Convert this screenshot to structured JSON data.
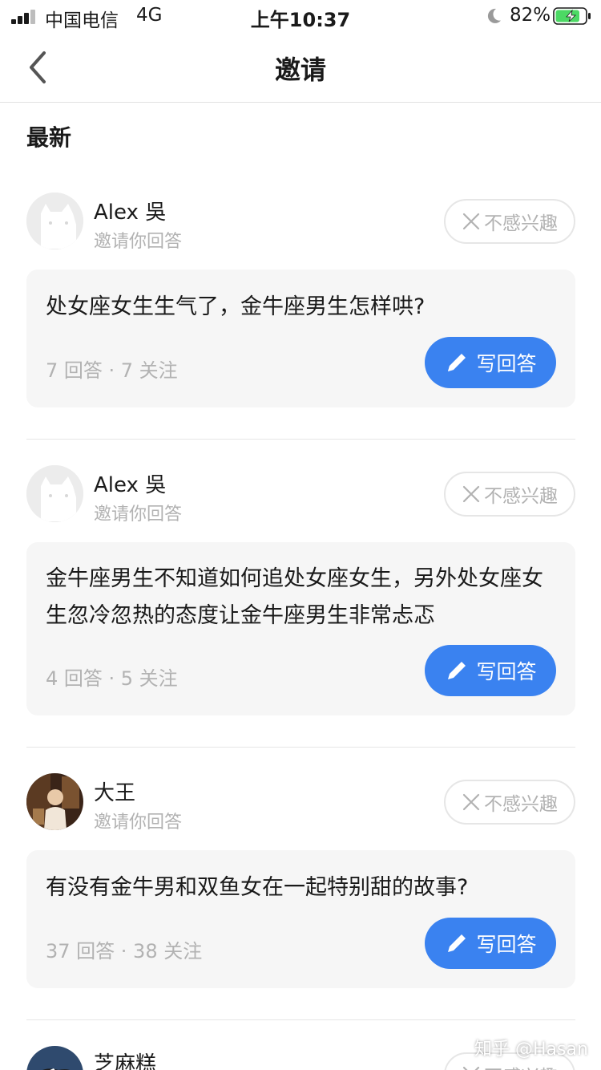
{
  "status_bar": {
    "carrier": "中国电信",
    "network": "4G",
    "time": "上午10:37",
    "battery_pct": "82%",
    "battery_level": 0.82,
    "icons": [
      "signal-icon",
      "moon-icon",
      "battery-charging-icon"
    ]
  },
  "nav": {
    "title": "邀请",
    "back_icon": "chevron-left-icon"
  },
  "section": {
    "title": "最新"
  },
  "invites": [
    {
      "inviter": "Alex 吳",
      "sub": "邀请你回答",
      "dismiss": "不感兴趣",
      "question": "处女座女生生气了，金牛座男生怎样哄?",
      "stats": "7 回答 · 7 关注",
      "answer": "写回答"
    },
    {
      "inviter": "Alex 吳",
      "sub": "邀请你回答",
      "dismiss": "不感兴趣",
      "question": "金牛座男生不知道如何追处女座女生，另外处女座女生忽冷忽热的态度让金牛座男生非常忐忑",
      "stats": "4 回答 · 5 关注",
      "answer": "写回答"
    },
    {
      "inviter": "大王",
      "sub": "邀请你回答",
      "dismiss": "不感兴趣",
      "question": "有没有金牛男和双鱼女在一起特别甜的故事?",
      "stats": "37 回答 · 38 关注",
      "answer": "写回答"
    },
    {
      "inviter": "芝麻糕",
      "dismiss": "不感兴趣"
    }
  ],
  "watermark": "知乎 @Hasan",
  "colors": {
    "accent": "#3a82f0",
    "muted_text": "#b2b2b2",
    "card_bg": "#f6f6f6",
    "battery_green": "#4cd964"
  }
}
